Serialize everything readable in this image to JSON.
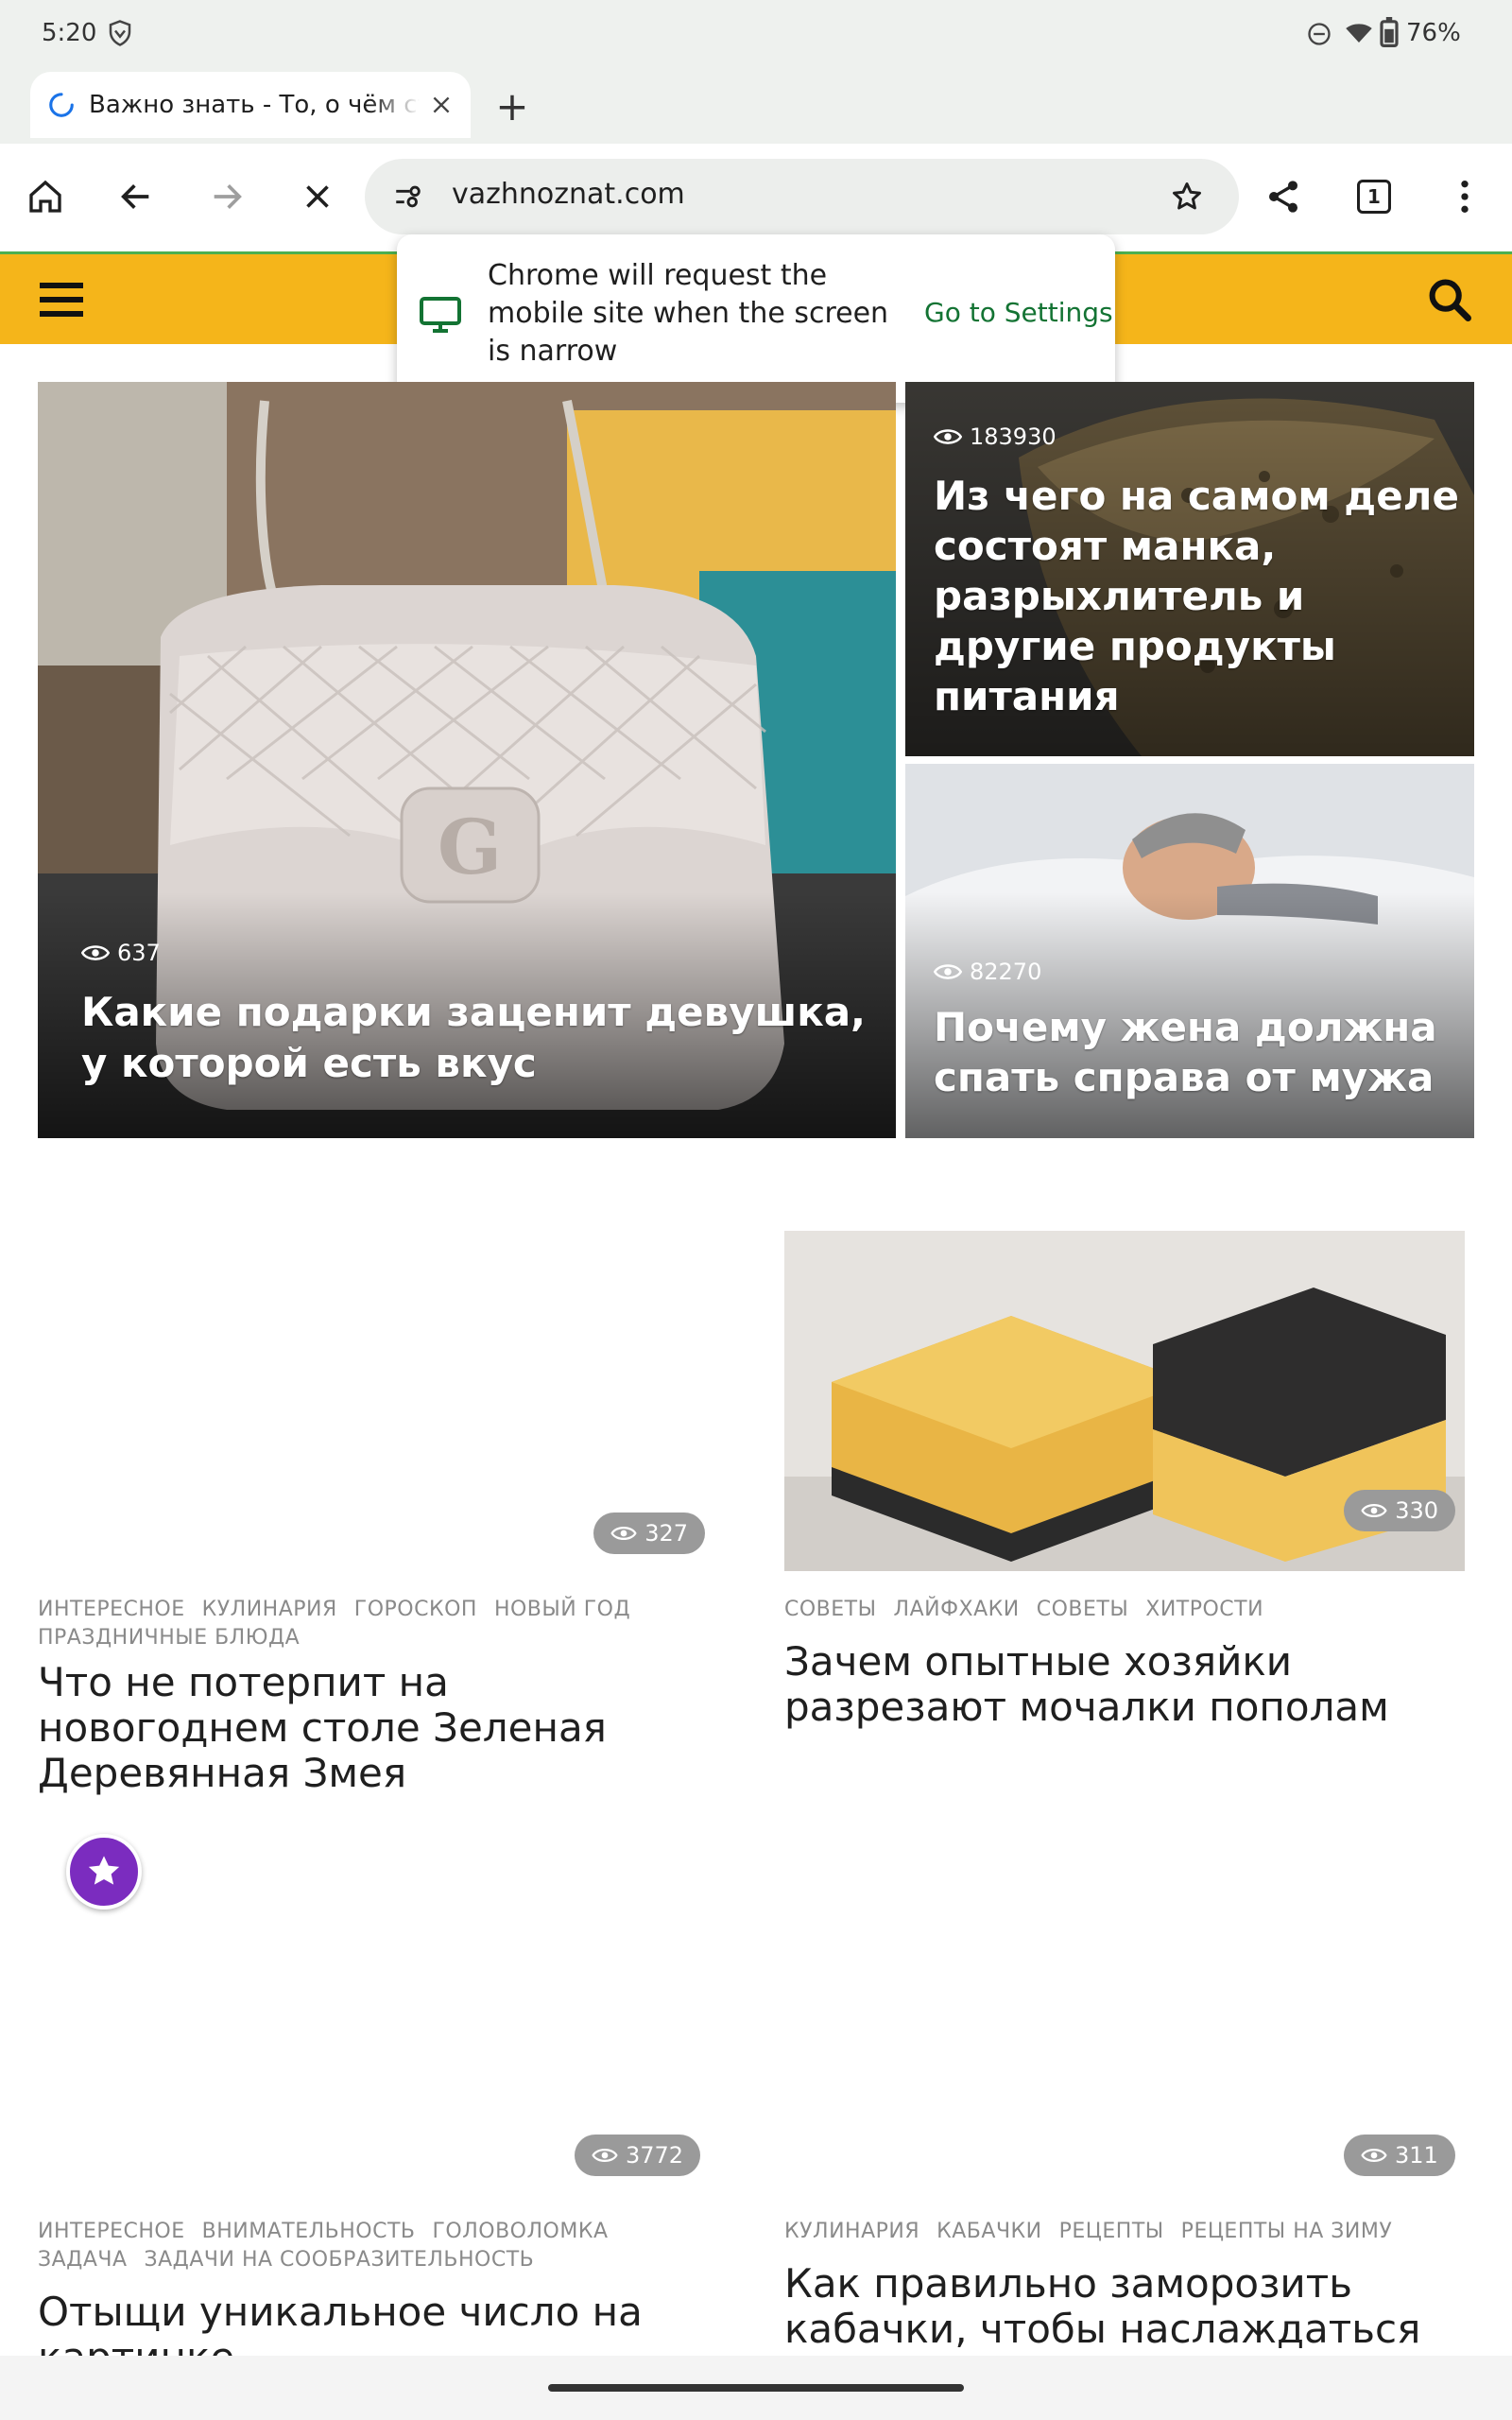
{
  "status": {
    "time": "5:20",
    "battery": "76%"
  },
  "tab": {
    "title": "Важно знать - То, о чём ст",
    "new_tab": "+"
  },
  "omnibox": {
    "url": "vazhnoznat.com"
  },
  "tab_count": "1",
  "popup": {
    "message": "Chrome will request the mobile site when the screen is narrow",
    "action": "Go to Settings"
  },
  "hero": {
    "main": {
      "views": "637",
      "title": "Какие подарки заценит девушка, у которой есть вкус"
    },
    "top_right": {
      "views": "183930",
      "title": "Из чего на самом деле состоят манка, разрыхлитель и другие продукты питания"
    },
    "bottom_right": {
      "views": "82270",
      "title": "Почему жена должна спать справа от мужа"
    }
  },
  "articles": [
    {
      "views": "327",
      "tags": [
        "ИНТЕРЕСНОЕ",
        "КУЛИНАРИЯ",
        "ГОРОСКОП",
        "НОВЫЙ ГОД",
        "ПРАЗДНИЧНЫЕ БЛЮДА"
      ],
      "title": "Что не потерпит на новогоднем столе Зеленая Деревянная Змея"
    },
    {
      "views": "330",
      "tags": [
        "СОВЕТЫ",
        "ЛАЙФХАКИ",
        "СОВЕТЫ",
        "ХИТРОСТИ"
      ],
      "title": "Зачем опытные хозяйки разрезают мочалки пополам"
    },
    {
      "views": "3772",
      "tags": [
        "ИНТЕРЕСНОЕ",
        "ВНИМАТЕЛЬНОСТЬ",
        "ГОЛОВОЛОМКА",
        "ЗАДАЧА",
        "ЗАДАЧИ НА СООБРАЗИТЕЛЬНОСТЬ"
      ],
      "title": "Отыщи уникальное число на картинке"
    },
    {
      "views": "311",
      "tags": [
        "КУЛИНАРИЯ",
        "КАБАЧКИ",
        "РЕЦЕПТЫ",
        "РЕЦЕПТЫ НА ЗИМУ"
      ],
      "title": "Как правильно заморозить кабачки, чтобы наслаждаться"
    }
  ],
  "colors": {
    "site_header": "#f5b51a",
    "fab": "#7b2cbf",
    "settings_link": "#137333"
  }
}
